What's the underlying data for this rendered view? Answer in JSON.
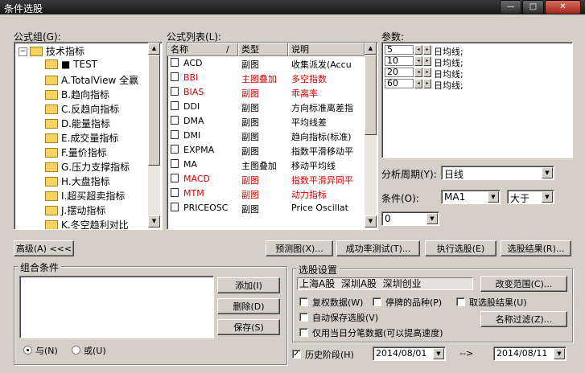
{
  "window": {
    "title": "条件选股",
    "min_label": "—",
    "max_label": "□",
    "close_label": "✕"
  },
  "formula_group": {
    "label": "公式组(G):",
    "root": "技术指标",
    "items": [
      "■ TEST",
      "A.TotalView 全赢",
      "B.趋向指标",
      "C.反趋向指标",
      "D.能量指标",
      "E.成交量指标",
      "F.量价指标",
      "G.压力支撑指标",
      "H.大盘指标",
      "I.超买超卖指标",
      "J.摆动指标",
      "K.冬空趋利对比"
    ]
  },
  "formula_list": {
    "label": "公式列表(L):",
    "headers": [
      "名称",
      "/",
      "类型",
      "说明"
    ],
    "rows": [
      {
        "name": "ACD",
        "type": "副图",
        "desc": "收集派发(Accu",
        "red": false
      },
      {
        "name": "BBI",
        "type": "主图叠加",
        "desc": "多空指数",
        "red": true
      },
      {
        "name": "BIAS",
        "type": "副图",
        "desc": "乖离率",
        "red": true
      },
      {
        "name": "DDI",
        "type": "副图",
        "desc": "方向标准离差指",
        "red": false
      },
      {
        "name": "DMA",
        "type": "副图",
        "desc": "平均线差",
        "red": false
      },
      {
        "name": "DMI",
        "type": "副图",
        "desc": "趋向指标(标准)",
        "red": false
      },
      {
        "name": "EXPMA",
        "type": "副图",
        "desc": "指数平滑移动平",
        "red": false
      },
      {
        "name": "MA",
        "type": "主图叠加",
        "desc": "移动平均线",
        "red": false
      },
      {
        "name": "MACD",
        "type": "副图",
        "desc": "指数平滑异同平",
        "red": true
      },
      {
        "name": "MTM",
        "type": "副图",
        "desc": "动力指标",
        "red": true
      },
      {
        "name": "PRICEOSC",
        "type": "副图",
        "desc": "Price Oscillat",
        "red": false
      }
    ]
  },
  "params": {
    "label": "参数:",
    "rows": [
      {
        "value": "5",
        "suffix": "日均线;"
      },
      {
        "value": "10",
        "suffix": "日均线;"
      },
      {
        "value": "20",
        "suffix": "日均线;"
      },
      {
        "value": "60",
        "suffix": "日均线;"
      }
    ]
  },
  "period": {
    "label": "分析周期(Y):",
    "value": "日线"
  },
  "condition": {
    "label": "条件(O):",
    "line": "MA1",
    "op": "大于",
    "value": "0"
  },
  "buttons": {
    "advanced": "高级(A) <<<",
    "preview": "预测图(X)...",
    "success_test": "成功率测试(T)...",
    "execute": "执行选股(E)",
    "results": "选股结果(R)..."
  },
  "combo": {
    "label": "组合条件",
    "add": "添加(I)",
    "delete": "删除(D)",
    "save": "保存(S)",
    "and_label": "与(N)",
    "or_label": "或(U)"
  },
  "settings": {
    "label": "选股设置",
    "scope": "上海A股  深圳A股  深圳创业",
    "change_scope": "改变范围(C)...",
    "fq": "复权数据(W)",
    "halted": "停牌的品种(P)",
    "take_results": "取选股结果(U)",
    "autosave": "自动保存选股(V)",
    "intraday": "仅用当日分笔数据(可以提高速度)",
    "name_filter": "名称过滤(Z)..."
  },
  "history": {
    "label": "历史阶段(H)",
    "start": "2014/08/01",
    "arrow": "-->",
    "end": "2014/08/11"
  }
}
